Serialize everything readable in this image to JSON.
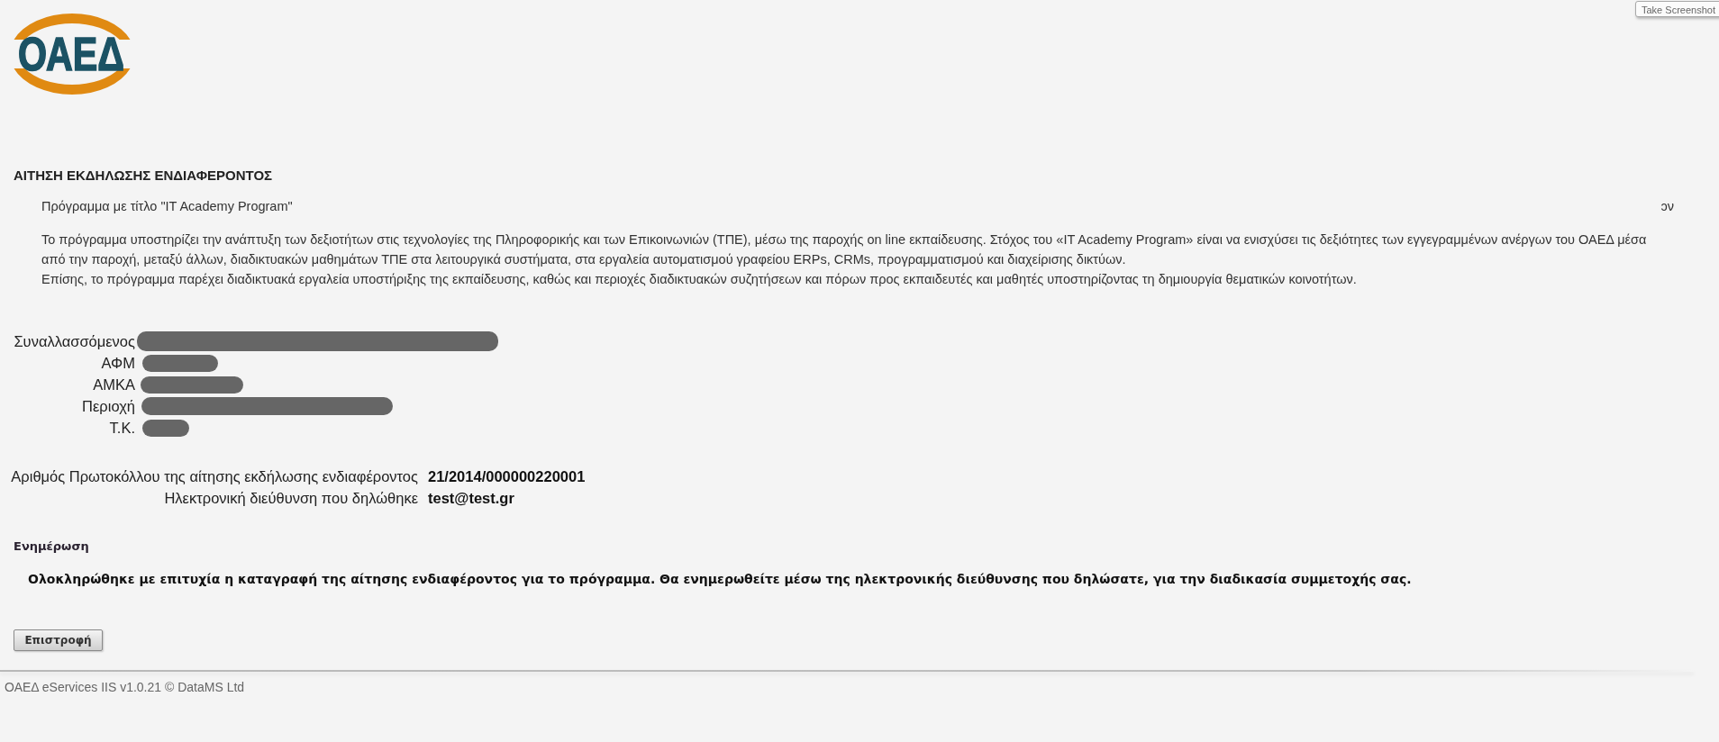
{
  "header": {
    "logo_text": "ΟΑΕΔ"
  },
  "tooltip": "Take Screenshot",
  "application": {
    "title": "ΑΙΤΗΣΗ ΕΚΔΗΛΩΣΗΣ ΕΝΔΙΑΦΕΡΟΝΤΟΣ",
    "program_title": "Πρόγραμμα με τίτλο \"IT Academy Program\"",
    "fragment": "ɔν",
    "description": [
      "Το πρόγραμμα υποστηρίζει την ανάπτυξη των δεξιοτήτων στις τεχνολογίες της Πληροφορικής και των Επικοινωνιών (ΤΠΕ), μέσω της παροχής on line εκπαίδευσης. Στόχος του «IT Academy Program» είναι να ενισχύσει τις δεξιότητες των εγγεγραμμένων ανέργων του ΟΑΕΔ μέσα από την παροχή, μεταξύ άλλων, διαδικτυακών μαθημάτων ΤΠΕ στα λειτουργικά συστήματα, στα εργαλεία αυτοματισμού γραφείου ERPs, CRMs, προγραμματισμού και διαχείρισης δικτύων.",
      "Επίσης, το πρόγραμμα παρέχει διαδικτυακά εργαλεία υποστήριξης της εκπαίδευσης, καθώς και περιοχές διαδικτυακών συζητήσεων και πόρων προς εκπαιδευτές και μαθητές υποστηρίζοντας τη δημιουργία θεματικών κοινοτήτων."
    ]
  },
  "applicant_fields": [
    {
      "label": "Συναλλασσόμενος",
      "redacted": true
    },
    {
      "label": "ΑΦΜ",
      "redacted": true
    },
    {
      "label": "ΑΜΚΑ",
      "redacted": true
    },
    {
      "label": "Περιοχή",
      "redacted": true
    },
    {
      "label": "Τ.Κ.",
      "redacted": true
    }
  ],
  "submission": [
    {
      "label": "Αριθμός Πρωτοκόλλου της αίτησης εκδήλωσης ενδιαφέροντος",
      "value": "21/2014/000000220001"
    },
    {
      "label": "Ηλεκτρονική διεύθυνση που δηλώθηκε",
      "value": "test@test.gr"
    }
  ],
  "notice": {
    "heading": "Ενημέρωση",
    "message": "Ολοκληρώθηκε με επιτυχία η καταγραφή της αίτησης ενδιαφέροντος για το πρόγραμμα. Θα ενημερωθείτε μέσω της ηλεκτρονικής διεύθυνσης που δηλώσατε, για την διαδικασία συμμετοχής σας."
  },
  "buttons": [
    "Επιστροφή"
  ],
  "footer": "ΟΑΕΔ eServices IIS v1.0.21 © DataMS Ltd"
}
